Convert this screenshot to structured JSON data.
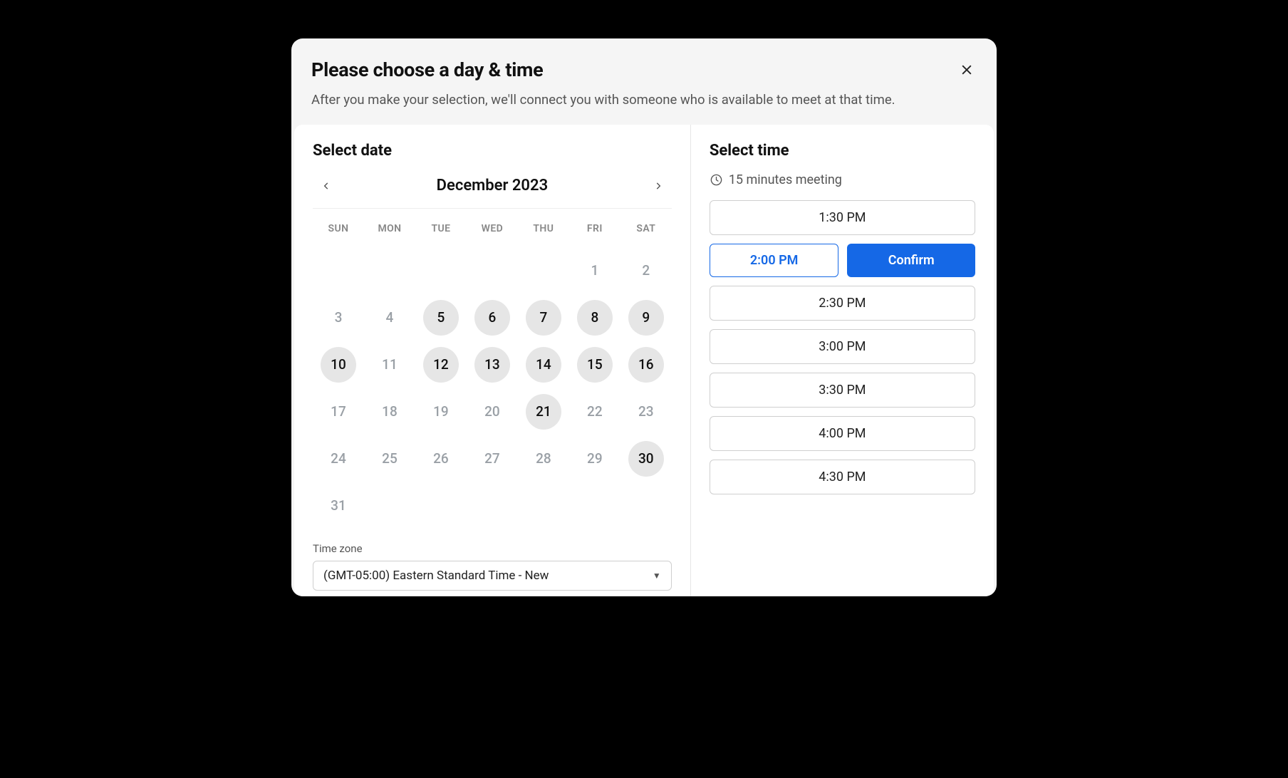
{
  "modal": {
    "title": "Please choose a day & time",
    "subtitle": "After you make your selection, we'll connect you with someone who is available to meet at that time."
  },
  "date_panel": {
    "title": "Select date",
    "month_label": "December 2023",
    "weekdays": [
      "SUN",
      "MON",
      "TUE",
      "WED",
      "THU",
      "FRI",
      "SAT"
    ],
    "days": [
      {
        "n": "",
        "a": false
      },
      {
        "n": "",
        "a": false
      },
      {
        "n": "",
        "a": false
      },
      {
        "n": "",
        "a": false
      },
      {
        "n": "",
        "a": false
      },
      {
        "n": "1",
        "a": false
      },
      {
        "n": "2",
        "a": false
      },
      {
        "n": "3",
        "a": false
      },
      {
        "n": "4",
        "a": false
      },
      {
        "n": "5",
        "a": true
      },
      {
        "n": "6",
        "a": true
      },
      {
        "n": "7",
        "a": true
      },
      {
        "n": "8",
        "a": true
      },
      {
        "n": "9",
        "a": true
      },
      {
        "n": "10",
        "a": true
      },
      {
        "n": "11",
        "a": false
      },
      {
        "n": "12",
        "a": true
      },
      {
        "n": "13",
        "a": true
      },
      {
        "n": "14",
        "a": true
      },
      {
        "n": "15",
        "a": true
      },
      {
        "n": "16",
        "a": true
      },
      {
        "n": "17",
        "a": false
      },
      {
        "n": "18",
        "a": false
      },
      {
        "n": "19",
        "a": false
      },
      {
        "n": "20",
        "a": false
      },
      {
        "n": "21",
        "a": true
      },
      {
        "n": "22",
        "a": false
      },
      {
        "n": "23",
        "a": false
      },
      {
        "n": "24",
        "a": false
      },
      {
        "n": "25",
        "a": false
      },
      {
        "n": "26",
        "a": false
      },
      {
        "n": "27",
        "a": false
      },
      {
        "n": "28",
        "a": false
      },
      {
        "n": "29",
        "a": false
      },
      {
        "n": "30",
        "a": true
      },
      {
        "n": "31",
        "a": false
      }
    ],
    "tz_label": "Time zone",
    "tz_value": "(GMT-05:00) Eastern Standard Time - New"
  },
  "time_panel": {
    "title": "Select time",
    "meeting_length": "15 minutes meeting",
    "slots": [
      "1:30 PM",
      "2:00 PM",
      "2:30 PM",
      "3:00 PM",
      "3:30 PM",
      "4:00 PM",
      "4:30 PM"
    ],
    "selected_slot": "2:00 PM",
    "confirm_label": "Confirm"
  }
}
